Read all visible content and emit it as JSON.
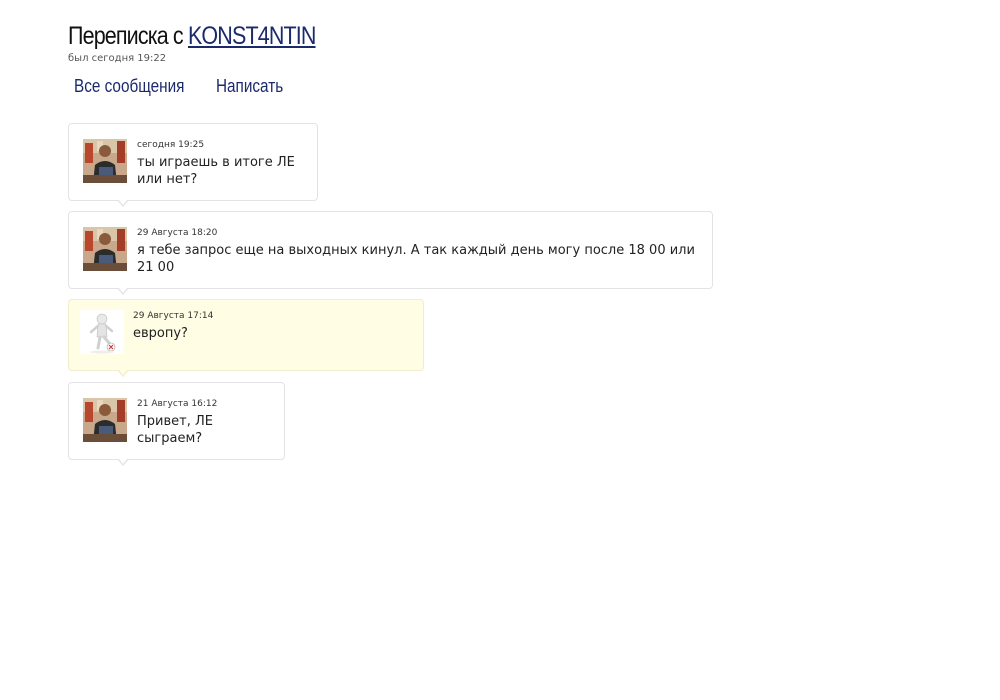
{
  "header": {
    "title_prefix": "Переписка с",
    "username": "KONST4NTIN",
    "last_seen": "был сегодня 19:22"
  },
  "nav": {
    "all_messages": "Все сообщения",
    "write": "Написать"
  },
  "messages": [
    {
      "avatar": "user-photo-icon",
      "time": "сегодня 19:25",
      "text": "ты играешь в итоге ЛЕ или нет?"
    },
    {
      "avatar": "user-photo-icon",
      "time": "29 Августа 18:20",
      "text": "я тебе запрос еще на выходных кинул. А так каждый день могу после 18 00 или 21 00"
    },
    {
      "avatar": "self-avatar-figure-icon",
      "time": "29 Августа 17:14",
      "text": "европу?",
      "mine": true
    },
    {
      "avatar": "user-photo-icon",
      "time": "21 Августа 16:12",
      "text": "Привет, ЛЕ сыграем?"
    }
  ],
  "colors": {
    "link": "#1b2a6b",
    "own_message_bg": "#fffde3",
    "message_border": "#e3e3e3"
  }
}
